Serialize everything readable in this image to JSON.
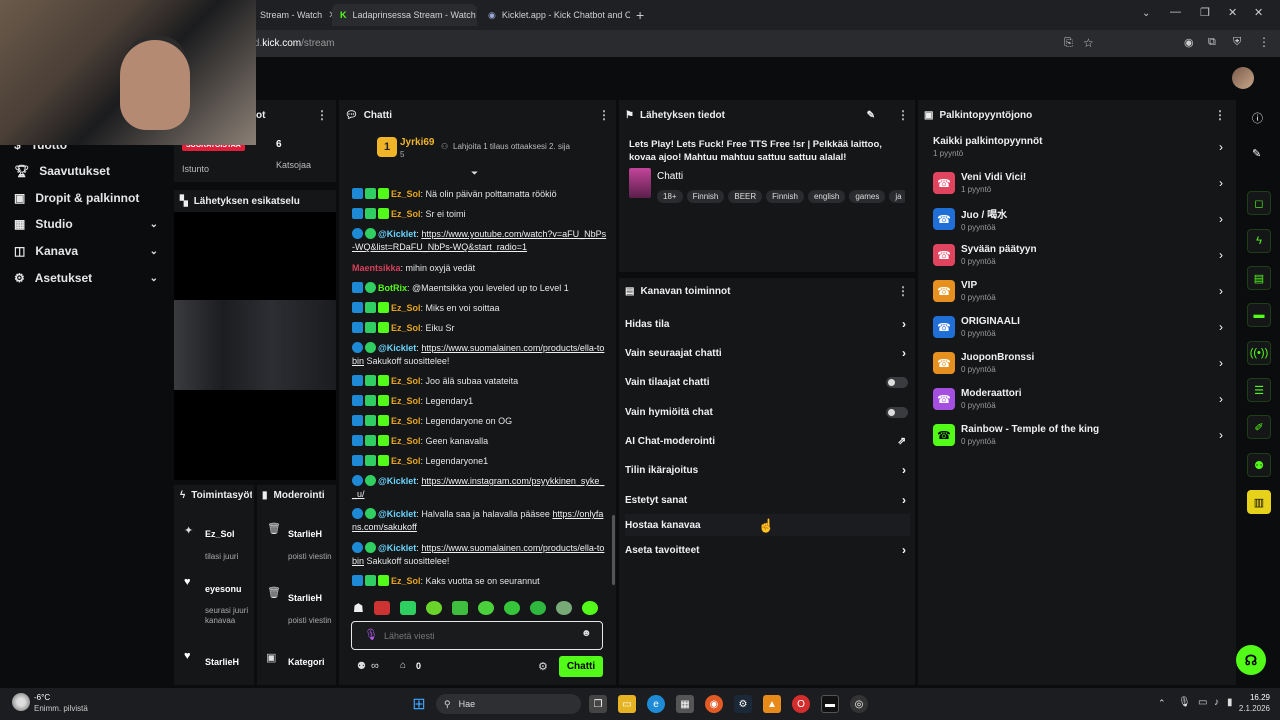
{
  "browser": {
    "tabs": [
      {
        "label": "Stream - Watch"
      },
      {
        "label": "Ladaprinsessa Stream - Watch L"
      },
      {
        "label": "Kicklet.app - Kick Chatbot and C"
      }
    ],
    "url_prefix": "ard.",
    "url_domain": "kick.com",
    "url_path": "/stream"
  },
  "sidebar": {
    "items": [
      {
        "label": "Tuotto",
        "icon": "dollar-icon"
      },
      {
        "label": "Saavutukset",
        "icon": "trophy-icon"
      },
      {
        "label": "Dropit & palkinnot",
        "icon": "gift-icon"
      },
      {
        "label": "Studio",
        "icon": "studio-icon"
      },
      {
        "label": "Kanava",
        "icon": "channel-icon"
      },
      {
        "label": "Asetukset",
        "icon": "gear-icon"
      }
    ]
  },
  "stats": {
    "header_suffix": "ot",
    "live_badge": "SUORATOISTAA",
    "session_label": "Istunto",
    "viewers_value": "6",
    "viewers_label": "Katsojaa"
  },
  "preview": {
    "title": "Lähetyksen esikatselu"
  },
  "activity": {
    "title": "Toimintasyöte",
    "items": [
      {
        "user": "Ez_Sol",
        "text": "tilasi juuri"
      },
      {
        "user": "eyesonu",
        "text": "seurasi juuri kanavaa"
      },
      {
        "user": "StarlieH",
        "text": ""
      }
    ]
  },
  "moderation": {
    "title": "Moderointi",
    "items": [
      {
        "user": "StarlieH",
        "text": "poisti viestin"
      },
      {
        "user": "StarlieH",
        "text": "poisti viestin"
      },
      {
        "user": "Kategori",
        "text": ""
      }
    ]
  },
  "chat": {
    "title": "Chatti",
    "gift_user": "Jyrki69",
    "gift_count": "5",
    "gift_rank": "1",
    "gift_text": "Lahjoita 1 tilaus ottaaksesi 2. sija",
    "messages": [
      {
        "user": "Ez_Sol",
        "text": "Nä olin päivän polttamatta röökiö",
        "type": "sol"
      },
      {
        "user": "Ez_Sol",
        "text": "Sr ei toimi",
        "type": "sol"
      },
      {
        "user": "@Kicklet",
        "text": "",
        "link": "https://www.youtube.com/watch?v=aFU_NbPs-WQ&list=RDaFU_NbPs-WQ&start_radio=1",
        "type": "kick"
      },
      {
        "user": "Maentsikka",
        "text": "mihin oxyjä vedät",
        "type": "maen"
      },
      {
        "user": "BotRix",
        "text": "@Maentsikka you leveled up to Level 1",
        "type": "botrix"
      },
      {
        "user": "Ez_Sol",
        "text": "Miks en voi soittaa",
        "type": "sol"
      },
      {
        "user": "Ez_Sol",
        "text": "Eiku Sr",
        "type": "sol"
      },
      {
        "user": "@Kicklet",
        "text": "Sakukoff suosittelee!",
        "link": "https://www.suomalainen.com/products/ella-tobin",
        "type": "kick"
      },
      {
        "user": "Ez_Sol",
        "text": "Joo älä subaa vatateita",
        "type": "sol"
      },
      {
        "user": "Ez_Sol",
        "text": "Legendary1",
        "type": "sol"
      },
      {
        "user": "Ez_Sol",
        "text": "Legendaryone on OG",
        "type": "sol"
      },
      {
        "user": "Ez_Sol",
        "text": "Geen kanavalla",
        "type": "sol"
      },
      {
        "user": "Ez_Sol",
        "text": "Legendaryone1",
        "type": "sol"
      },
      {
        "user": "@Kicklet",
        "text": "",
        "link": "https://www.instagram.com/psyykkinen_syke__u/",
        "type": "kick"
      },
      {
        "user": "@Kicklet",
        "text": "Halvalla saa ja halavalla pääsee ",
        "link": "https://onlyfans.com/sakukoff",
        "type": "kick2"
      },
      {
        "user": "@Kicklet",
        "text": "Sakukoff suosittelee!",
        "link": "https://www.suomalainen.com/products/ella-tobin",
        "type": "kick"
      },
      {
        "user": "Ez_Sol",
        "text": "Kaks vuotta se on seurannut",
        "type": "sol"
      }
    ],
    "input_placeholder": "Lähetä viesti",
    "points_value": "0",
    "send_label": "Chatti"
  },
  "stream_info": {
    "title": "Lähetyksen tiedot",
    "stream_title": "Lets Play! Lets Fuck! Free TTS Free !sr | Pelkkää laittoo, kovaa ajoo! Mahtuu mahtuu sattuu sattuu alalal!",
    "category": "Chatti",
    "tags": [
      "18+",
      "Finnish",
      "BEER",
      "Finnish",
      "english",
      "games",
      "ja"
    ]
  },
  "channel_actions": {
    "title": "Kanavan toiminnot",
    "items": [
      {
        "label": "Hidas tila",
        "kind": "arrow"
      },
      {
        "label": "Vain seuraajat chatti",
        "kind": "arrow"
      },
      {
        "label": "Vain tilaajat chatti",
        "kind": "toggle"
      },
      {
        "label": "Vain hymiöitä chat",
        "kind": "toggle"
      },
      {
        "label": "AI Chat-moderointi",
        "kind": "external"
      },
      {
        "label": "Tilin ikärajoitus",
        "kind": "arrow"
      },
      {
        "label": "Estetyt sanat",
        "kind": "arrow"
      },
      {
        "label": "Hostaa kanavaa",
        "kind": "none"
      },
      {
        "label": "Aseta tavoitteet",
        "kind": "arrow"
      }
    ]
  },
  "rewards": {
    "title": "Palkintopyyntöjono",
    "all_label": "Kaikki palkintopyynnöt",
    "all_count": "1 pyyntö",
    "items": [
      {
        "name": "Veni Vidi Vici!",
        "count": "1 pyyntö",
        "color": "#e0445f"
      },
      {
        "name": "Juo / 喝水",
        "count": "0 pyyntöä",
        "color": "#1f6fd6"
      },
      {
        "name": "Syvään päätyyn",
        "count": "0 pyyntöä",
        "color": "#e0445f"
      },
      {
        "name": "VIP",
        "count": "0 pyyntöä",
        "color": "#e6901f"
      },
      {
        "name": "ORIGINAALI",
        "count": "0 pyyntöä",
        "color": "#1f6fd6"
      },
      {
        "name": "JuoponBronssi",
        "count": "0 pyyntöä",
        "color": "#e6901f"
      },
      {
        "name": "Moderaattori",
        "count": "0 pyyntöä",
        "color": "#a44fe0"
      },
      {
        "name": "Rainbow - Temple of the king",
        "count": "0 pyyntöä",
        "color": "#53fc18"
      }
    ]
  },
  "taskbar": {
    "temp": "-6°C",
    "weather": "Enimm. pilvistä",
    "search_label": "Hae",
    "time": "16.29",
    "date": "2.1.2026"
  },
  "colors": {
    "accent": "#53fc18",
    "panel": "#151618",
    "bg": "#0b0c0e"
  }
}
